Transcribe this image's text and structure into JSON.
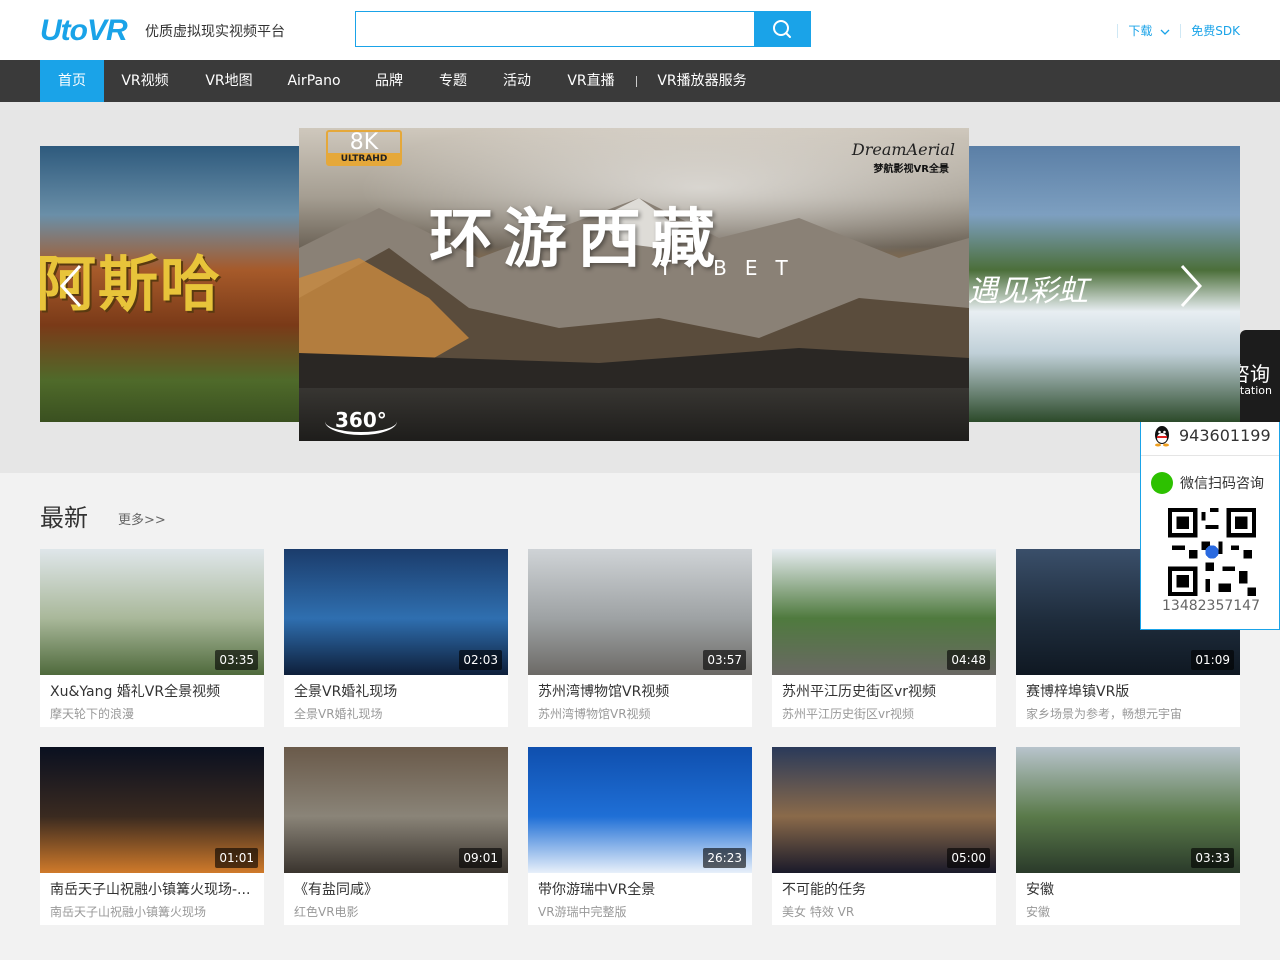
{
  "header": {
    "logo": "UtoVR",
    "slogan": "优质虚拟现实视频平台",
    "search_placeholder": "",
    "download_label": "下载",
    "sdk_label": "免费SDK"
  },
  "nav": {
    "items": [
      {
        "label": "首页"
      },
      {
        "label": "VR视频"
      },
      {
        "label": "VR地图"
      },
      {
        "label": "AirPano"
      },
      {
        "label": "品牌"
      },
      {
        "label": "专题"
      },
      {
        "label": "活动"
      },
      {
        "label": "VR直播"
      },
      {
        "label": "VR播放器服务"
      }
    ]
  },
  "banner": {
    "left_text": "阿斯哈",
    "right_text": "遇见彩虹",
    "main": {
      "badge": "8K",
      "badge_sub": "ULTRAHD",
      "brand": "DreamAerial",
      "brand_sub": "梦航影视VR全景",
      "title": "环游西藏",
      "subtitle": "TIBET",
      "badge_360": "360°"
    }
  },
  "section": {
    "title": "最新",
    "more": "更多>>"
  },
  "cards": [
    {
      "title": "Xu&Yang 婚礼VR全景视频",
      "sub": "摩天轮下的浪漫",
      "duration": "03:35",
      "colors": [
        "#dfe6ea",
        "#a9b89a",
        "#4f6a3c"
      ]
    },
    {
      "title": "全景VR婚礼现场",
      "sub": "全景VR婚礼现场",
      "duration": "02:03",
      "colors": [
        "#1b3c6b",
        "#2f6fb0",
        "#0e1f3a"
      ]
    },
    {
      "title": "苏州湾博物馆VR视频",
      "sub": "苏州湾博物馆VR视频",
      "duration": "03:57",
      "colors": [
        "#cfd3d6",
        "#9ea2a4",
        "#6c6a66"
      ]
    },
    {
      "title": "苏州平江历史街区vr视频",
      "sub": "苏州平江历史街区vr视频",
      "duration": "04:48",
      "colors": [
        "#e6ecf0",
        "#4f7a3e",
        "#6a6864"
      ]
    },
    {
      "title": "赛博梓埠镇VR版",
      "sub": "家乡场景为参考，畅想元宇宙",
      "duration": "01:09",
      "colors": [
        "#3a4f6a",
        "#1f2d3d",
        "#0f1822"
      ]
    },
    {
      "title": "南岳天子山祝融小镇篝火现场-...",
      "sub": "南岳天子山祝融小镇篝火现场",
      "duration": "01:01",
      "colors": [
        "#0a1020",
        "#3a2a20",
        "#d07a2a"
      ]
    },
    {
      "title": "《有盐同咸》",
      "sub": "红色VR电影",
      "duration": "09:01",
      "colors": [
        "#6a5a4a",
        "#8a8478",
        "#3a342e"
      ]
    },
    {
      "title": "带你游瑞中VR全景",
      "sub": "VR游瑞中完整版",
      "duration": "26:23",
      "colors": [
        "#0f4fae",
        "#1f6fd6",
        "#e8f0fa"
      ]
    },
    {
      "title": "不可能的任务",
      "sub": "美女 特效 VR",
      "duration": "05:00",
      "colors": [
        "#2a3a5a",
        "#8a6a4a",
        "#1a1a2a"
      ]
    },
    {
      "title": "安徽",
      "sub": "安徽",
      "duration": "03:33",
      "colors": [
        "#b8c4cc",
        "#5a7a4a",
        "#2a3a2a"
      ]
    }
  ],
  "consult": {
    "title": "咨询",
    "subtitle": "tation",
    "qq": "943601199",
    "wechat_label": "微信扫码咨询",
    "phone": "13482357147"
  },
  "colors": {
    "accent": "#1aa3e8",
    "nav_bg": "#3a3a3a"
  }
}
